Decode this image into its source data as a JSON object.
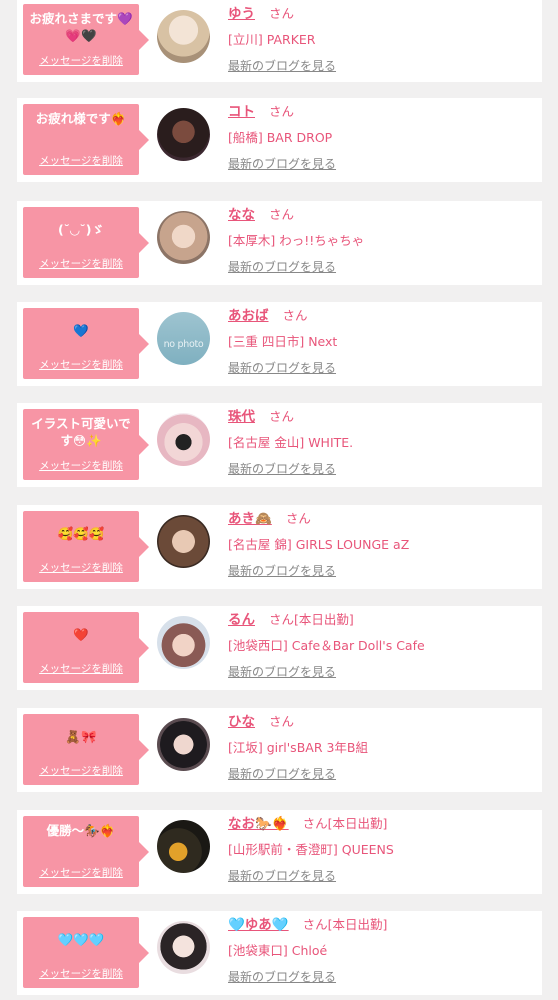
{
  "colors": {
    "page_background": "#f1f0f0",
    "card_background": "#ffffff",
    "bubble": "#f795a5",
    "name_text": "#e8557a",
    "blog_link": "#888888"
  },
  "messages": [
    {
      "message": "お疲れさまです💜💗🖤",
      "delete_label": "メッセージを削除",
      "name": "ゆう",
      "honorific": "さん",
      "status": "",
      "shop": "[立川] PARKER",
      "blog_link": "最新のブログを見る",
      "photo_placeholder": ""
    },
    {
      "message": "お疲れ様です❤️‍🔥",
      "delete_label": "メッセージを削除",
      "name": "コト",
      "honorific": "さん",
      "status": "",
      "shop": "[船橋] BAR DROP",
      "blog_link": "最新のブログを見る",
      "photo_placeholder": ""
    },
    {
      "message": "(˘◡˘)ゞ",
      "delete_label": "メッセージを削除",
      "name": "なな",
      "honorific": "さん",
      "status": "",
      "shop": "[本厚木] わっ!!ちゃちゃ",
      "blog_link": "最新のブログを見る",
      "photo_placeholder": ""
    },
    {
      "message": "💙",
      "delete_label": "メッセージを削除",
      "name": "あおば",
      "honorific": "さん",
      "status": "",
      "shop": "[三重 四日市] Next",
      "blog_link": "最新のブログを見る",
      "photo_placeholder": "no photo"
    },
    {
      "message": "イラスト可愛いです😳✨",
      "delete_label": "メッセージを削除",
      "name": "珠代",
      "honorific": "さん",
      "status": "",
      "shop": "[名古屋 金山] WHITE.",
      "blog_link": "最新のブログを見る",
      "photo_placeholder": ""
    },
    {
      "message": "🥰🥰🥰",
      "delete_label": "メッセージを削除",
      "name": "あき🙈",
      "honorific": "さん",
      "status": "",
      "shop": "[名古屋 錦] GIRLS LOUNGE aZ",
      "blog_link": "最新のブログを見る",
      "photo_placeholder": ""
    },
    {
      "message": "❤️",
      "delete_label": "メッセージを削除",
      "name": "るん",
      "honorific": "さん",
      "status": "[本日出勤]",
      "shop": "[池袋西口] Cafe＆Bar Doll's Cafe",
      "blog_link": "最新のブログを見る",
      "photo_placeholder": ""
    },
    {
      "message": "🧸🎀",
      "delete_label": "メッセージを削除",
      "name": "ひな",
      "honorific": "さん",
      "status": "",
      "shop": "[江坂] girl'sBAR 3年B組",
      "blog_link": "最新のブログを見る",
      "photo_placeholder": ""
    },
    {
      "message": "優勝〜🏇❤️‍🔥",
      "delete_label": "メッセージを削除",
      "name": "なお🐎❤️‍🔥",
      "honorific": "さん",
      "status": "[本日出勤]",
      "shop": "[山形駅前・香澄町] QUEENS",
      "blog_link": "最新のブログを見る",
      "photo_placeholder": ""
    },
    {
      "message": "🩵🩵🩵",
      "delete_label": "メッセージを削除",
      "name": "🩵ゆあ🩵",
      "honorific": "さん",
      "status": "[本日出勤]",
      "shop": "[池袋東口] Chloé",
      "blog_link": "最新のブログを見る",
      "photo_placeholder": ""
    }
  ]
}
